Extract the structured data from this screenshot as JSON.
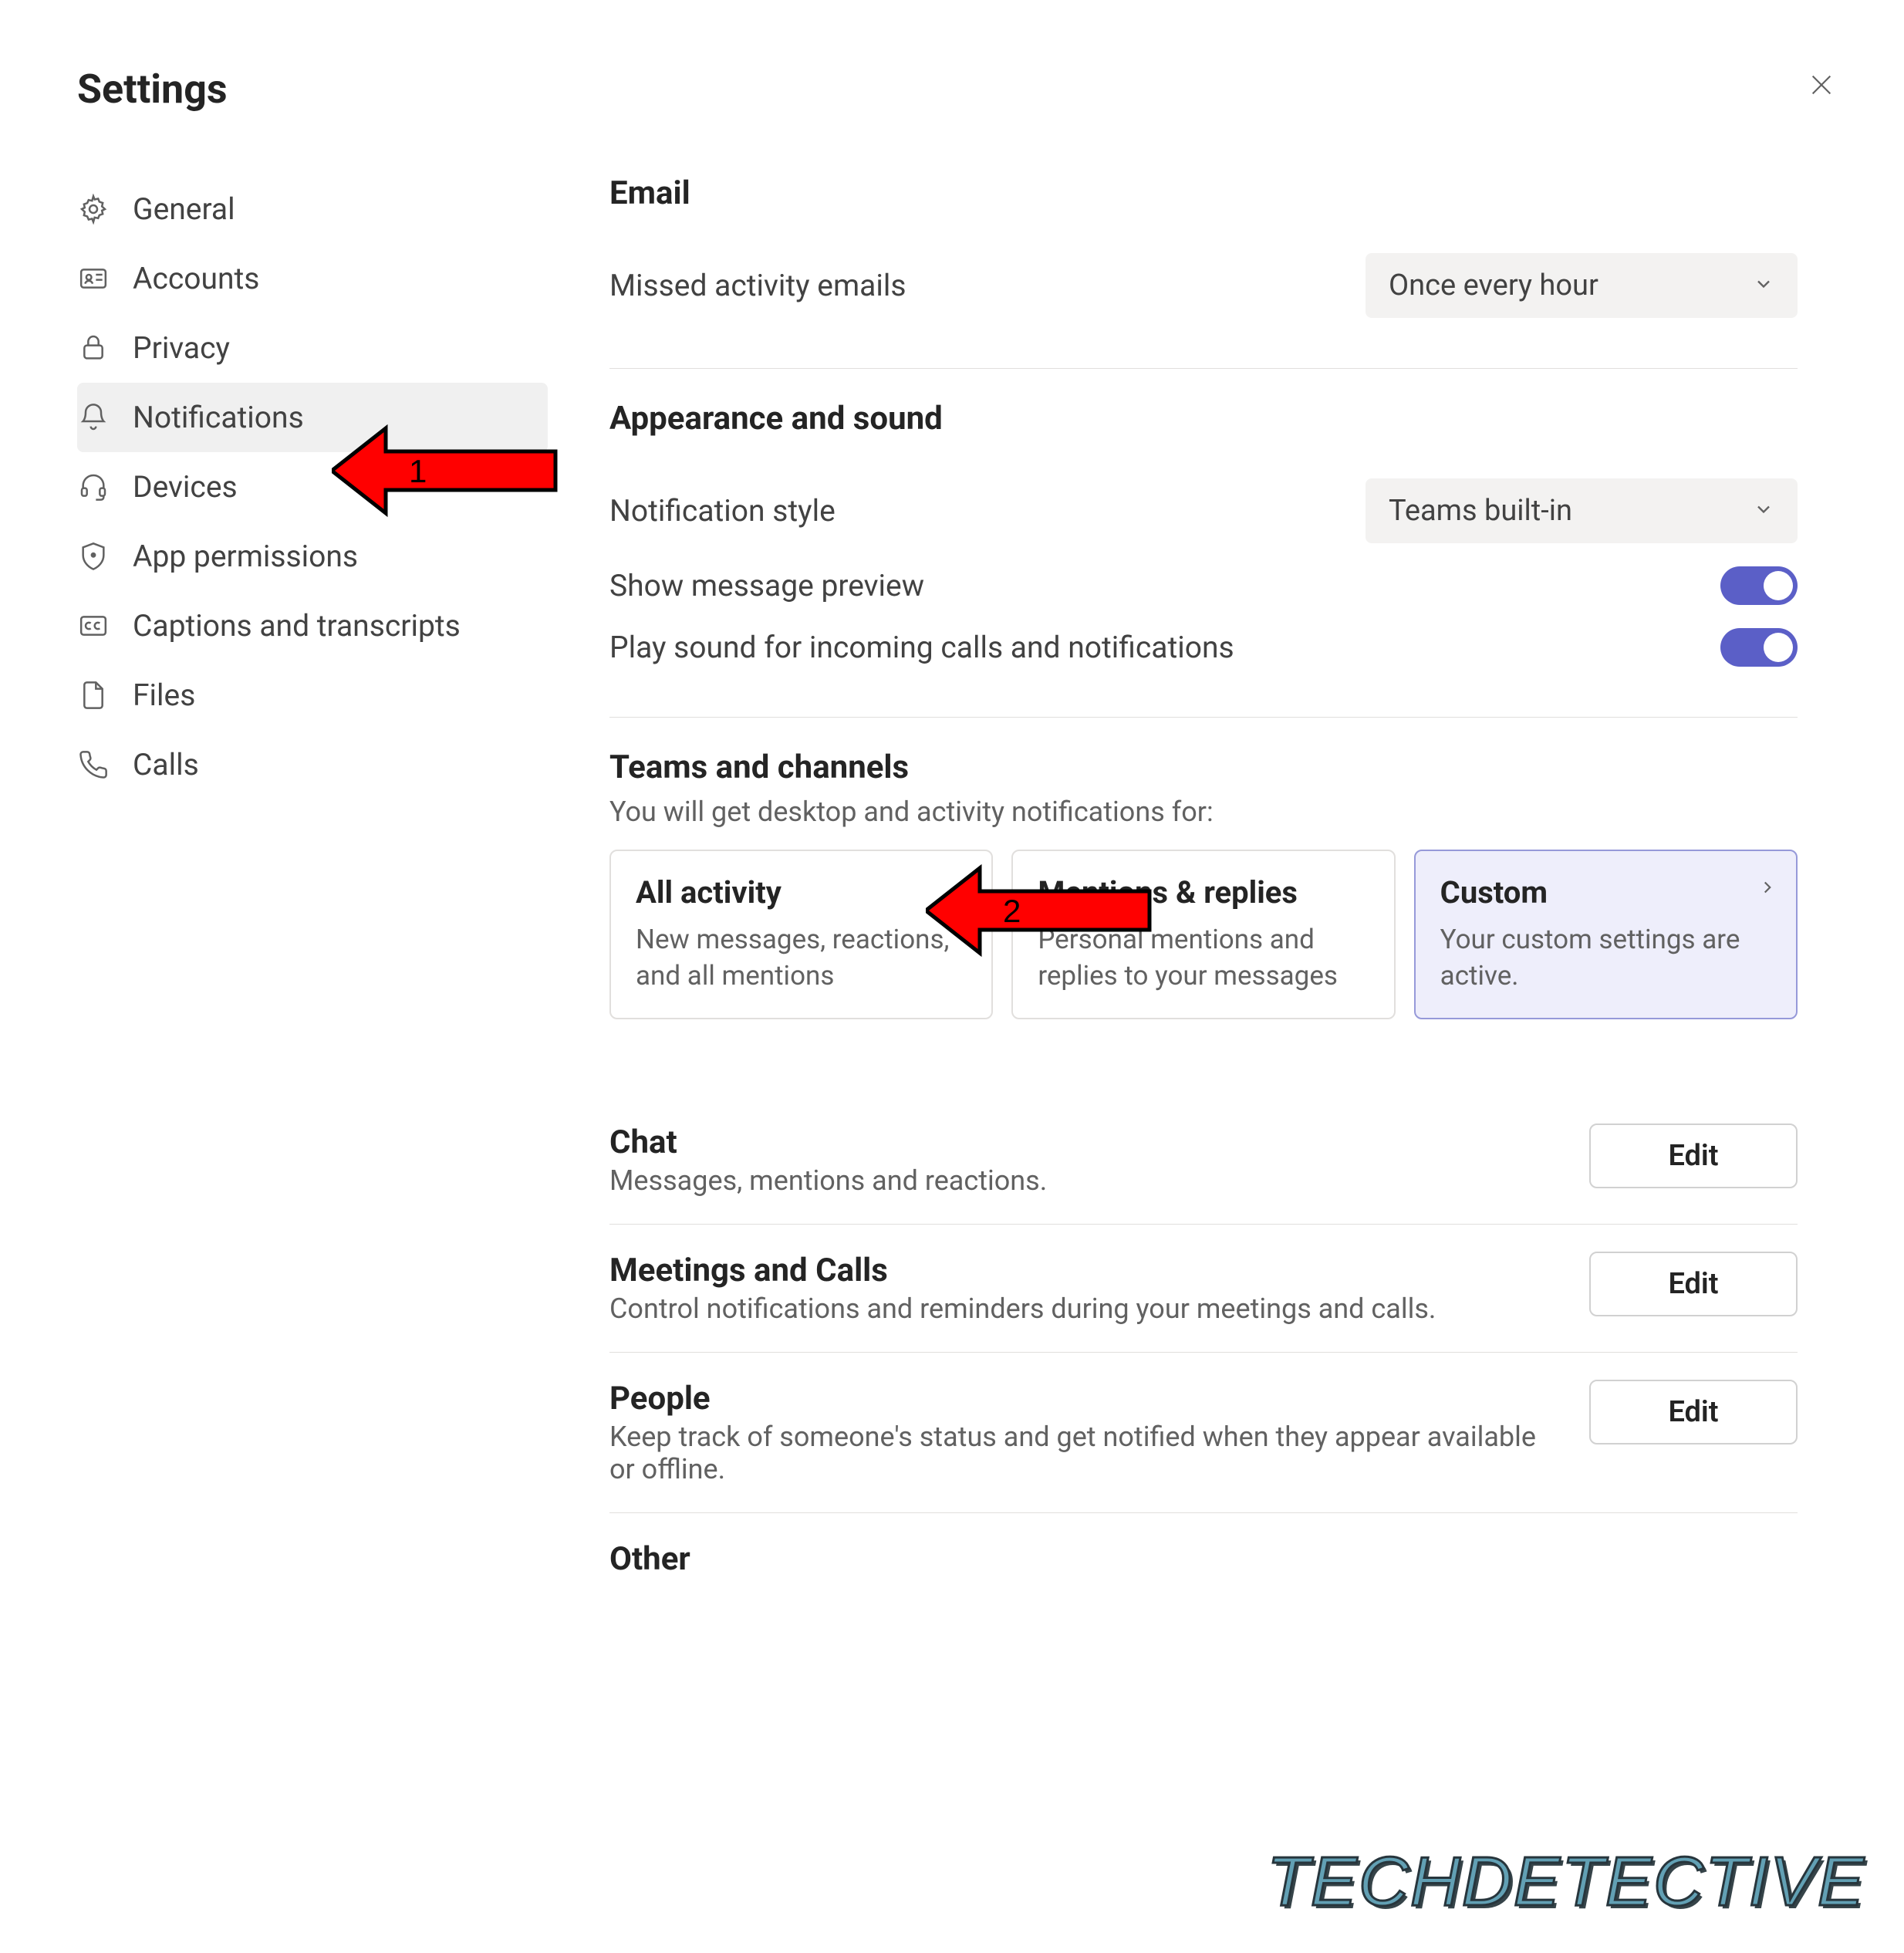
{
  "header": {
    "title": "Settings"
  },
  "sidebar": {
    "items": [
      {
        "label": "General",
        "icon": "gear"
      },
      {
        "label": "Accounts",
        "icon": "id-card"
      },
      {
        "label": "Privacy",
        "icon": "lock"
      },
      {
        "label": "Notifications",
        "icon": "bell",
        "active": true
      },
      {
        "label": "Devices",
        "icon": "headset"
      },
      {
        "label": "App permissions",
        "icon": "shield"
      },
      {
        "label": "Captions and transcripts",
        "icon": "cc"
      },
      {
        "label": "Files",
        "icon": "file"
      },
      {
        "label": "Calls",
        "icon": "phone"
      }
    ]
  },
  "email": {
    "title": "Email",
    "missed_label": "Missed activity emails",
    "missed_value": "Once every hour"
  },
  "appearance": {
    "title": "Appearance and sound",
    "style_label": "Notification style",
    "style_value": "Teams built-in",
    "preview_label": "Show message preview",
    "sound_label": "Play sound for incoming calls and notifications"
  },
  "teams": {
    "title": "Teams and channels",
    "desc": "You will get desktop and activity notifications for:",
    "cards": [
      {
        "title": "All activity",
        "desc": "New messages, reactions, and all mentions"
      },
      {
        "title": "Mentions & replies",
        "desc": "Personal mentions and replies to your messages"
      },
      {
        "title": "Custom",
        "desc": "Your custom settings are active.",
        "selected": true
      }
    ]
  },
  "chat": {
    "title": "Chat",
    "desc": "Messages, mentions and reactions.",
    "button": "Edit"
  },
  "meetings": {
    "title": "Meetings and Calls",
    "desc": "Control notifications and reminders during your meetings and calls.",
    "button": "Edit"
  },
  "people": {
    "title": "People",
    "desc": "Keep track of someone's status and get notified when they appear available or offline.",
    "button": "Edit"
  },
  "other": {
    "title": "Other"
  },
  "annotations": {
    "arrow1": "1",
    "arrow2": "2"
  },
  "watermark": "TECHDETECTIVE"
}
